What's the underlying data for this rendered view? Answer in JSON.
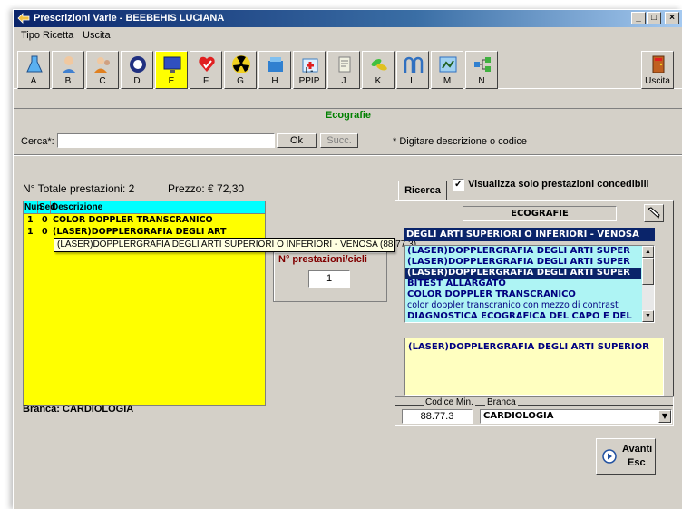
{
  "window": {
    "title": "Prescrizioni Varie - BEEBEHIS LUCIANA"
  },
  "menu": {
    "items": [
      "Tipo Ricetta",
      "Uscita"
    ]
  },
  "toolbar": {
    "tools": [
      {
        "label": "A",
        "icon": "flask-icon"
      },
      {
        "label": "B",
        "icon": "doctor-icon"
      },
      {
        "label": "C",
        "icon": "people-icon"
      },
      {
        "label": "D",
        "icon": "emblem-icon"
      },
      {
        "label": "E",
        "icon": "monitor-icon",
        "active": true
      },
      {
        "label": "F",
        "icon": "heart-check-icon"
      },
      {
        "label": "G",
        "icon": "radiation-icon"
      },
      {
        "label": "H",
        "icon": "box-icon"
      },
      {
        "label": "I - PPIP",
        "icon": "medkit-icon"
      },
      {
        "label": "J",
        "icon": "scroll-icon"
      },
      {
        "label": "K",
        "icon": "pills-icon"
      },
      {
        "label": "L",
        "icon": "arches-icon"
      },
      {
        "label": "M",
        "icon": "map-icon"
      },
      {
        "label": "N",
        "icon": "network-icon"
      }
    ],
    "exit_label": "Uscita"
  },
  "section": {
    "title": "Ecografie"
  },
  "search": {
    "label": "Cerca*:",
    "value": "",
    "ok_label": "Ok",
    "next_label": "Succ.",
    "hint": "* Digitare descrizione o codice"
  },
  "summary": {
    "totale": "N° Totale prestazioni: 2",
    "prezzo": "Prezzo: € 72,30"
  },
  "grid": {
    "headers": [
      "Nun",
      "Sed",
      "Descrizione"
    ],
    "rows": [
      {
        "num": "1",
        "sed": "0",
        "desc": "COLOR DOPPLER TRANSCRANICO"
      },
      {
        "num": "1",
        "sed": "0",
        "desc": "(LASER)DOPPLERGRAFIA DEGLI ART"
      }
    ]
  },
  "tooltip": "(LASER)DOPPLERGRAFIA DEGLI ARTI SUPERIORI O INFERIORI - VENOSA (88.77.3)",
  "nprest": {
    "label": "N° prestazioni/cicli",
    "value": "1"
  },
  "branca_left": "Branca: CARDIOLOGIA",
  "ricerca": {
    "tab_label": "Ricerca",
    "checkbox_label": "Visualizza solo prestazioni concedibili",
    "checkbox_checked": true,
    "category": "ECOGRAFIE",
    "selected_text": "DEGLI ARTI SUPERIORI O INFERIORI - VENOSA",
    "list": [
      {
        "text": "(LASER)DOPPLERGRAFIA DEGLI ARTI SUPER",
        "selected": false,
        "thin": false
      },
      {
        "text": "(LASER)DOPPLERGRAFIA DEGLI ARTI SUPER",
        "selected": false,
        "thin": false
      },
      {
        "text": "(LASER)DOPPLERGRAFIA DEGLI ARTI SUPER",
        "selected": true,
        "thin": false
      },
      {
        "text": "BITEST ALLARGATO",
        "selected": false,
        "thin": false
      },
      {
        "text": "COLOR DOPPLER TRANSCRANICO",
        "selected": false,
        "thin": false
      },
      {
        "text": "color doppler transcranico con mezzo di contrast",
        "selected": false,
        "thin": true
      },
      {
        "text": "DIAGNOSTICA ECOGRAFICA DEL CAPO E DEL",
        "selected": false,
        "thin": false
      }
    ],
    "description": "(LASER)DOPPLERGRAFIA DEGLI ARTI SUPERIOR"
  },
  "codice": {
    "label": "Codice Min.",
    "value": "88.77.3"
  },
  "branca": {
    "label": "Branca",
    "value": "CARDIOLOGIA"
  },
  "avanti": {
    "line1": "Avanti",
    "line2": "Esc"
  },
  "colors": {
    "accent": "#0a246a",
    "grid_bg": "#ffff00",
    "grid_header": "#00ffff",
    "list_bg": "#aef4f4",
    "section_title": "#008000"
  }
}
